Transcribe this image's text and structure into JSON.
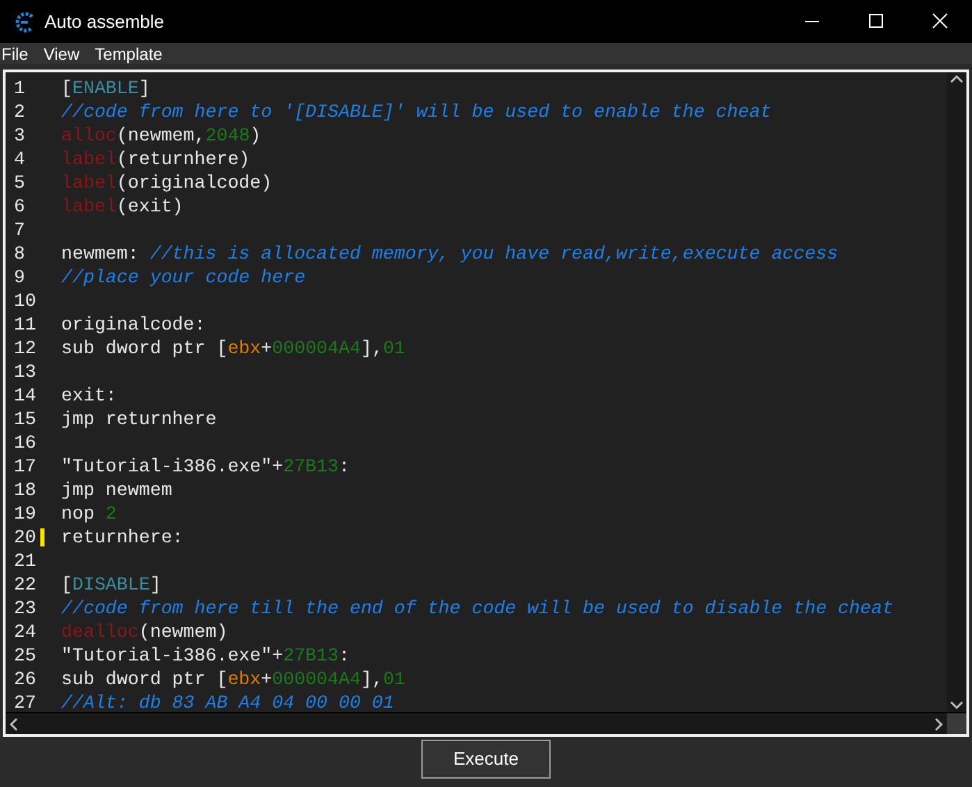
{
  "window": {
    "title": "Auto assemble"
  },
  "menu": [
    "File",
    "View",
    "Template"
  ],
  "editor": {
    "lines": [
      {
        "number": "1",
        "marked": false,
        "tokens": [
          {
            "kind": "plain",
            "text": "["
          },
          {
            "kind": "section",
            "text": "ENABLE"
          },
          {
            "kind": "plain",
            "text": "]"
          }
        ]
      },
      {
        "number": "2",
        "marked": false,
        "tokens": [
          {
            "kind": "comment",
            "text": "//code from here to '[DISABLE]' will be used to enable the cheat"
          }
        ]
      },
      {
        "number": "3",
        "marked": false,
        "tokens": [
          {
            "kind": "keyword",
            "text": "alloc"
          },
          {
            "kind": "plain",
            "text": "(newmem,"
          },
          {
            "kind": "number",
            "text": "2048"
          },
          {
            "kind": "plain",
            "text": ")"
          }
        ]
      },
      {
        "number": "4",
        "marked": false,
        "tokens": [
          {
            "kind": "keyword",
            "text": "label"
          },
          {
            "kind": "plain",
            "text": "(returnhere)"
          }
        ]
      },
      {
        "number": "5",
        "marked": false,
        "tokens": [
          {
            "kind": "keyword",
            "text": "label"
          },
          {
            "kind": "plain",
            "text": "(originalcode)"
          }
        ]
      },
      {
        "number": "6",
        "marked": false,
        "tokens": [
          {
            "kind": "keyword",
            "text": "label"
          },
          {
            "kind": "plain",
            "text": "(exit)"
          }
        ]
      },
      {
        "number": "7",
        "marked": false
      },
      {
        "number": "8",
        "marked": false,
        "tokens": [
          {
            "kind": "plain",
            "text": "newmem: "
          },
          {
            "kind": "comment",
            "text": "//this is allocated memory, you have read,write,execute access"
          }
        ]
      },
      {
        "number": "9",
        "marked": false,
        "tokens": [
          {
            "kind": "comment",
            "text": "//place your code here"
          }
        ]
      },
      {
        "number": "10",
        "marked": false
      },
      {
        "number": "11",
        "marked": false,
        "tokens": [
          {
            "kind": "plain",
            "text": "originalcode:"
          }
        ]
      },
      {
        "number": "12",
        "marked": false,
        "tokens": [
          {
            "kind": "plain",
            "text": "sub dword ptr ["
          },
          {
            "kind": "register",
            "text": "ebx"
          },
          {
            "kind": "plain",
            "text": "+"
          },
          {
            "kind": "number",
            "text": "000004A4"
          },
          {
            "kind": "plain",
            "text": "],"
          },
          {
            "kind": "number",
            "text": "01"
          }
        ]
      },
      {
        "number": "13",
        "marked": false
      },
      {
        "number": "14",
        "marked": false,
        "tokens": [
          {
            "kind": "plain",
            "text": "exit:"
          }
        ]
      },
      {
        "number": "15",
        "marked": false,
        "tokens": [
          {
            "kind": "plain",
            "text": "jmp returnhere"
          }
        ]
      },
      {
        "number": "16",
        "marked": false
      },
      {
        "number": "17",
        "marked": false,
        "tokens": [
          {
            "kind": "plain",
            "text": "\"Tutorial-i386.exe\"+"
          },
          {
            "kind": "number",
            "text": "27B13"
          },
          {
            "kind": "plain",
            "text": ":"
          }
        ]
      },
      {
        "number": "18",
        "marked": false,
        "tokens": [
          {
            "kind": "plain",
            "text": "jmp newmem"
          }
        ]
      },
      {
        "number": "19",
        "marked": false,
        "tokens": [
          {
            "kind": "plain",
            "text": "nop "
          },
          {
            "kind": "number",
            "text": "2"
          }
        ]
      },
      {
        "number": "20",
        "marked": true,
        "tokens": [
          {
            "kind": "plain",
            "text": "returnhere:"
          }
        ]
      },
      {
        "number": "21",
        "marked": false
      },
      {
        "number": "22",
        "marked": false,
        "tokens": [
          {
            "kind": "plain",
            "text": "["
          },
          {
            "kind": "section",
            "text": "DISABLE"
          },
          {
            "kind": "plain",
            "text": "]"
          }
        ]
      },
      {
        "number": "23",
        "marked": false,
        "tokens": [
          {
            "kind": "comment",
            "text": "//code from here till the end of the code will be used to disable the cheat"
          }
        ]
      },
      {
        "number": "24",
        "marked": false,
        "tokens": [
          {
            "kind": "keyword",
            "text": "dealloc"
          },
          {
            "kind": "plain",
            "text": "(newmem)"
          }
        ]
      },
      {
        "number": "25",
        "marked": false,
        "tokens": [
          {
            "kind": "plain",
            "text": "\"Tutorial-i386.exe\"+"
          },
          {
            "kind": "number",
            "text": "27B13"
          },
          {
            "kind": "plain",
            "text": ":"
          }
        ]
      },
      {
        "number": "26",
        "marked": false,
        "tokens": [
          {
            "kind": "plain",
            "text": "sub dword ptr ["
          },
          {
            "kind": "register",
            "text": "ebx"
          },
          {
            "kind": "plain",
            "text": "+"
          },
          {
            "kind": "number",
            "text": "000004A4"
          },
          {
            "kind": "plain",
            "text": "],"
          },
          {
            "kind": "number",
            "text": "01"
          }
        ]
      },
      {
        "number": "27",
        "marked": false,
        "tokens": [
          {
            "kind": "comment",
            "text": "//Alt: db 83 AB A4 04 00 00 01"
          }
        ]
      }
    ]
  },
  "buttons": [
    "Execute"
  ]
}
